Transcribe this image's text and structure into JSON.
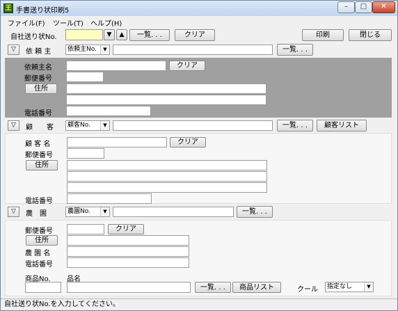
{
  "window": {
    "title": "手書送り状印刷5",
    "icon_text": "王",
    "min_label": "–",
    "max_label": "□",
    "close_label": "✕"
  },
  "menu": [
    {
      "label": "ファイル(F)"
    },
    {
      "label": "ツール(T)"
    },
    {
      "label": "ヘルプ(H)"
    }
  ],
  "toolbar": {
    "invoice_no_label": "自社送り状No.",
    "invoice_no_value": "",
    "down_label": "▼",
    "up_label": "▲",
    "list_label": "一覧. . .",
    "clear_label": "クリア",
    "print_label": "印刷",
    "close_label": "閉じる"
  },
  "requester": {
    "toggle": "▽",
    "title": "依 頼 主",
    "select_value": "依頼主No.",
    "search_value": "",
    "list_label": "一覧. . .",
    "name_label": "依頼主名",
    "clear_label": "クリア",
    "zip_label": "郵便番号",
    "address_button": "住所",
    "phone_label": "電話番号"
  },
  "customer": {
    "toggle": "▽",
    "title": "顧　　客",
    "select_value": "顧客No.",
    "search_value": "",
    "list_label": "一覧. . .",
    "customer_list_label": "顧客リスト",
    "name_label": "顧 客 名",
    "clear_label": "クリア",
    "zip_label": "郵便番号",
    "address_button": "住所",
    "phone_label": "電話番号"
  },
  "farm": {
    "toggle": "▽",
    "title": "農　園",
    "select_value": "農園No.",
    "search_value": "",
    "list_label": "一覧. . .",
    "zip_label": "郵便番号",
    "clear_label": "クリア",
    "address_button": "住所",
    "name_label": "農 園 名",
    "phone_label": "電話番号"
  },
  "product": {
    "no_label": "商品No.",
    "name_label": "品名",
    "list_label": "一覧. . .",
    "product_list_label": "商品リスト",
    "cool_label": "クール",
    "cool_value": "指定なし"
  },
  "status": {
    "text": "自社送り状No.を入力してください。"
  },
  "colors": {
    "requester_panel": "#a0a0a0",
    "highlight_input": "#ffffc0"
  }
}
